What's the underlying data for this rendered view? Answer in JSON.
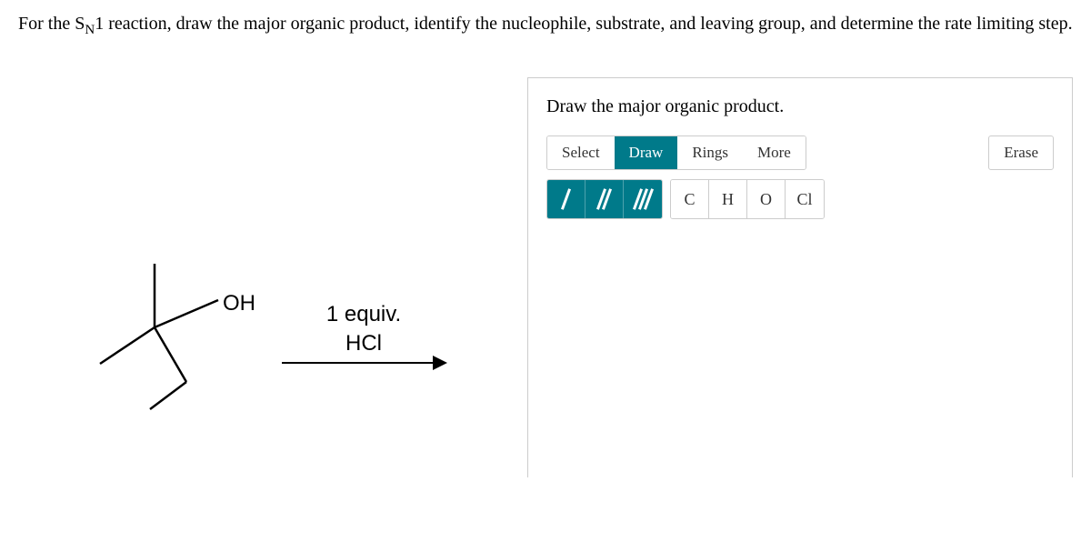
{
  "question": {
    "prefix": "For the S",
    "subscript": "N",
    "after_sub": "1 reaction, draw the major organic product, identify the nucleophile, substrate, and leaving group, and determine the rate limiting step."
  },
  "reagent": {
    "line1": "1 equiv.",
    "line2": "HCl"
  },
  "molecule_label": "OH",
  "panel": {
    "title": "Draw the major organic product."
  },
  "toolbar": {
    "select": "Select",
    "draw": "Draw",
    "rings": "Rings",
    "more": "More",
    "erase": "Erase"
  },
  "atoms": {
    "c": "C",
    "h": "H",
    "o": "O",
    "cl": "Cl"
  }
}
